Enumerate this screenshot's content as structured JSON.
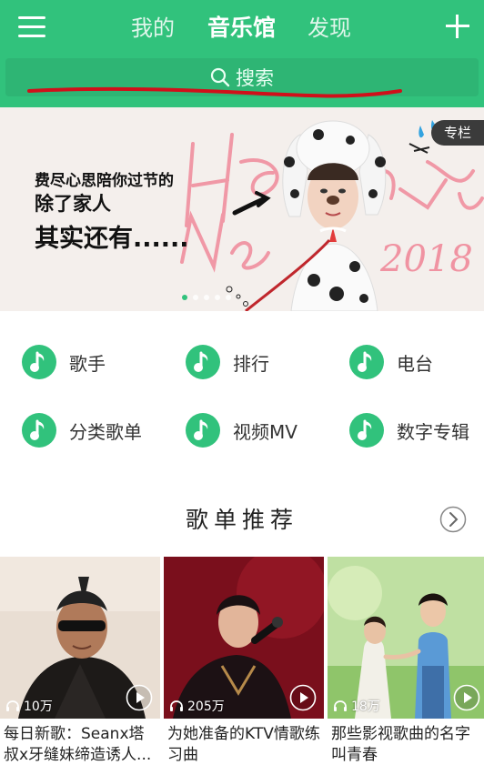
{
  "header": {
    "tabs": [
      {
        "label": "我的"
      },
      {
        "label": "音乐馆"
      },
      {
        "label": "发现"
      }
    ],
    "active_tab": "音乐馆",
    "icons": {
      "menu": "menu-icon",
      "add": "plus-icon"
    },
    "accent_color": "#31c27c"
  },
  "search": {
    "placeholder": "搜索"
  },
  "banner": {
    "line1": "费尽心思陪你过节的",
    "line2": "除了家人",
    "line3": "其实还有......",
    "badge": "专栏",
    "art_text": "Happy New Year 2018"
  },
  "categories": [
    {
      "label": "歌手",
      "icon": "music-note-icon"
    },
    {
      "label": "排行",
      "icon": "music-note-icon"
    },
    {
      "label": "电台",
      "icon": "music-note-icon"
    },
    {
      "label": "分类歌单",
      "icon": "music-note-icon"
    },
    {
      "label": "视频MV",
      "icon": "music-note-icon"
    },
    {
      "label": "数字专辑",
      "icon": "music-note-icon"
    }
  ],
  "section": {
    "title": "歌单推荐"
  },
  "playlists": [
    {
      "count": "10万",
      "title": "每日新歌：Seanx塔叔x牙缝妹缔造诱人..."
    },
    {
      "count": "205万",
      "title": "为她准备的KTV情歌练习曲"
    },
    {
      "count": "18万",
      "title": "那些影视歌曲的名字叫青春"
    }
  ]
}
